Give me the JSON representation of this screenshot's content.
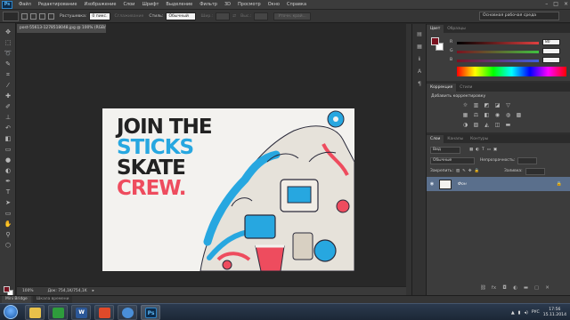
{
  "app": {
    "logo": "Ps",
    "menu": [
      "Файл",
      "Редактирование",
      "Изображение",
      "Слои",
      "Шрифт",
      "Выделение",
      "Фильтр",
      "3D",
      "Просмотр",
      "Окно",
      "Справка"
    ],
    "window_controls": [
      "–",
      "□",
      "×"
    ],
    "workspace": "Основная рабочая среда"
  },
  "options_bar": {
    "feather_label": "Растушевка:",
    "feather_value": "0 пикс.",
    "antialias_label": "Сглаживание",
    "style_label": "Стиль:",
    "style_value": "Обычный",
    "width_label": "Шир.:",
    "height_label": "Выс.:",
    "refine_edge_label": "Уточн. край..."
  },
  "document": {
    "tab_title": "post-55613-1278518048.jpg @ 100% (RGB/8#)",
    "zoom": "100%",
    "doc_size": "Док: 754,1K/754,1K",
    "poster_lines": [
      "JOIN THE",
      "STICKS",
      "SKATE",
      "CREW."
    ],
    "poster_colors": [
      "#222222",
      "#27a7e0",
      "#222222",
      "#ee4c5e"
    ]
  },
  "mini_bridge": {
    "tabs": [
      "Mini Bridge",
      "Шкала времени"
    ]
  },
  "panels": {
    "color": {
      "tabs": [
        "Цвет",
        "Образцы"
      ],
      "channels": [
        {
          "label": "R",
          "value": "80",
          "color": "#e04040"
        },
        {
          "label": "G",
          "value": "",
          "color": "#40c040"
        },
        {
          "label": "B",
          "value": "",
          "color": "#4060e0"
        }
      ]
    },
    "adjustments": {
      "tabs": [
        "Коррекция",
        "Стили"
      ],
      "title": "Добавить корректировку"
    },
    "layers": {
      "tabs": [
        "Слои",
        "Каналы",
        "Контуры"
      ],
      "kind_label": "Вид",
      "blend_mode": "Обычные",
      "opacity_label": "Непрозрачность:",
      "lock_label": "Закрепить:",
      "fill_label": "Заливка:",
      "layer_name": "Фон"
    }
  },
  "taskbar": {
    "language": "РУС",
    "time": "17:56",
    "date": "15.11.2014",
    "apps": [
      {
        "label": "",
        "color": "#e8c14a"
      },
      {
        "label": "",
        "color": "#2e9c3c"
      },
      {
        "label": "W",
        "color": "#2b5797"
      },
      {
        "label": "",
        "color": "#e04a2a"
      },
      {
        "label": "",
        "color": "#4a8fd8"
      },
      {
        "label": "Ps",
        "color": "#0c2b4a"
      }
    ]
  }
}
